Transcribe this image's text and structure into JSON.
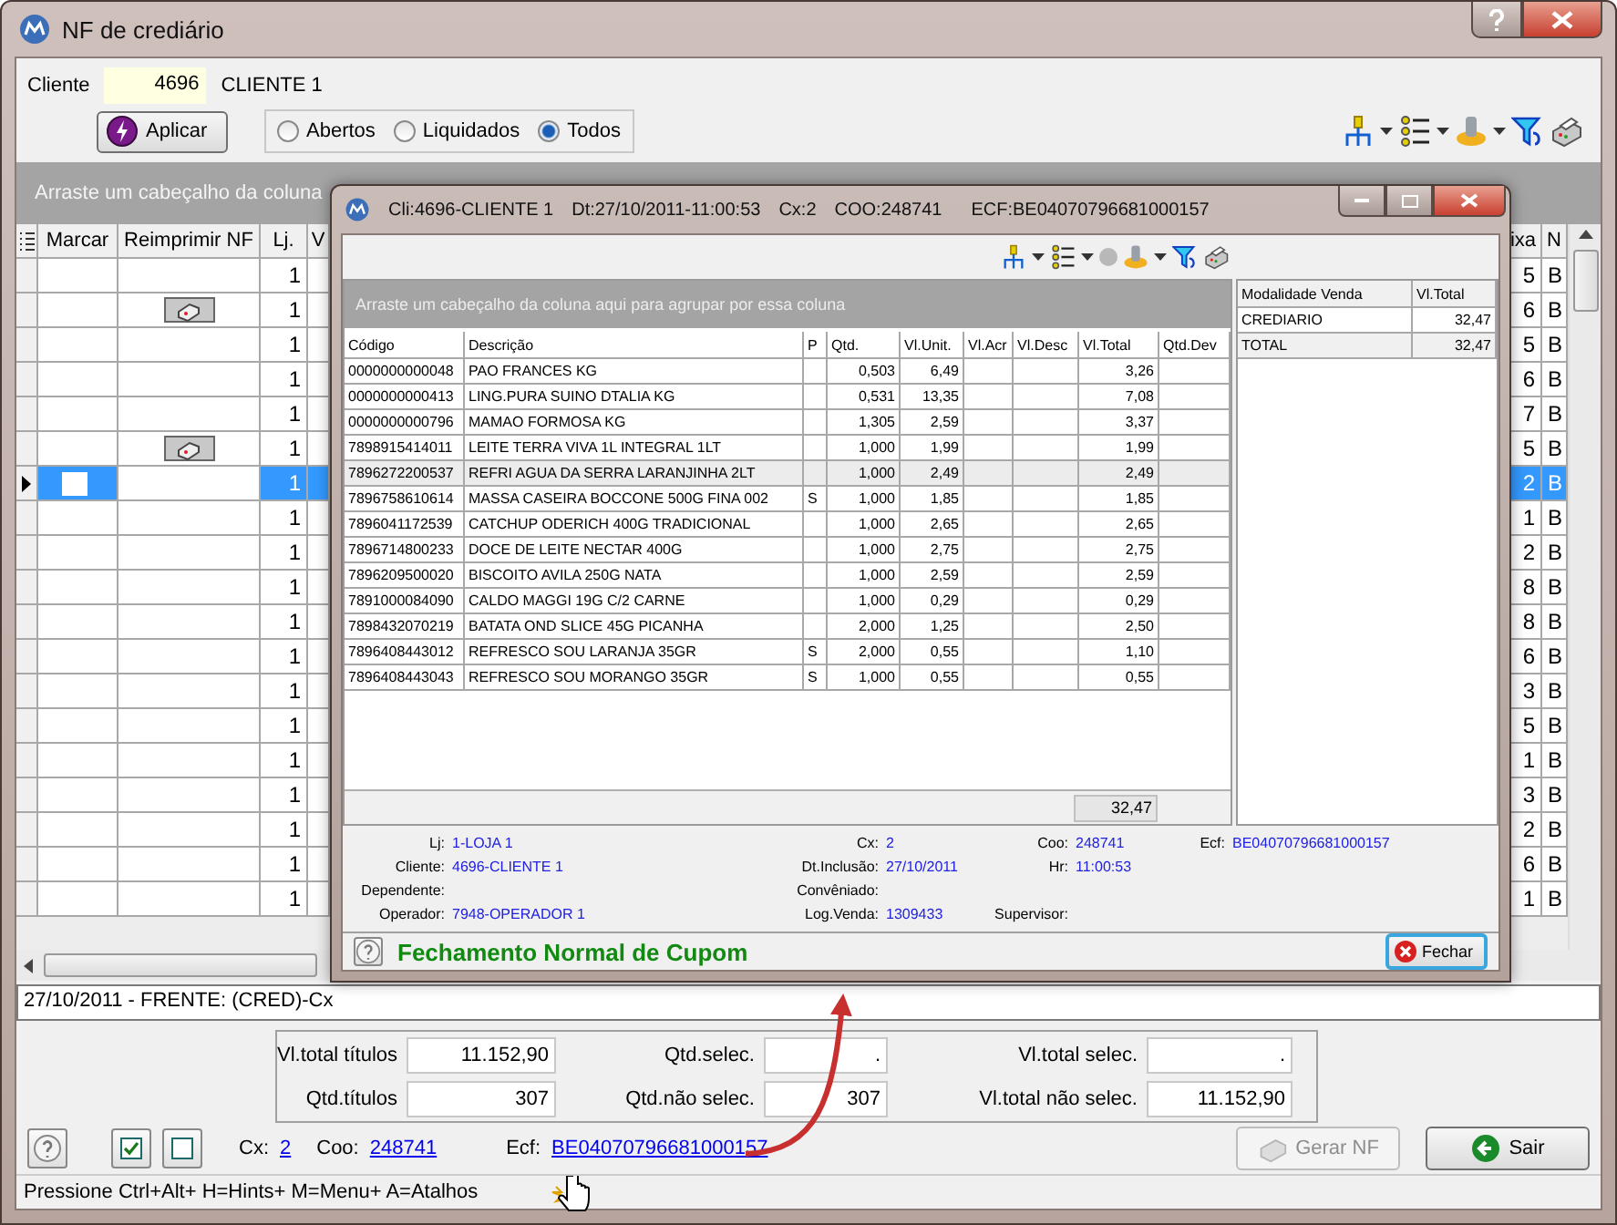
{
  "window": {
    "title": "NF de crediário"
  },
  "client": {
    "label": "Cliente",
    "code": "4696",
    "name": "CLIENTE 1"
  },
  "apply_button": "Aplicar",
  "filter": [
    {
      "label": "Abertos",
      "selected": false
    },
    {
      "label": "Liquidados",
      "selected": false
    },
    {
      "label": "Todos",
      "selected": true
    }
  ],
  "group_panel": "Arraste um cabeçalho da coluna",
  "grid": {
    "columns": [
      "Marcar",
      "Reimprimir NF",
      "Lj.",
      "V",
      "ixa",
      "N"
    ],
    "rows": [
      {
        "reprint": false,
        "lj": "1",
        "ixa": "5",
        "n": "B",
        "selected": false
      },
      {
        "reprint": true,
        "lj": "1",
        "ixa": "6",
        "n": "B",
        "selected": false
      },
      {
        "reprint": false,
        "lj": "1",
        "ixa": "5",
        "n": "B",
        "selected": false
      },
      {
        "reprint": false,
        "lj": "1",
        "ixa": "6",
        "n": "B",
        "selected": false
      },
      {
        "reprint": false,
        "lj": "1",
        "ixa": "7",
        "n": "B",
        "selected": false
      },
      {
        "reprint": true,
        "lj": "1",
        "ixa": "5",
        "n": "B",
        "selected": false
      },
      {
        "reprint": false,
        "lj": "1",
        "ixa": "2",
        "n": "B",
        "selected": true
      },
      {
        "reprint": false,
        "lj": "1",
        "ixa": "1",
        "n": "B",
        "selected": false
      },
      {
        "reprint": false,
        "lj": "1",
        "ixa": "2",
        "n": "B",
        "selected": false
      },
      {
        "reprint": false,
        "lj": "1",
        "ixa": "8",
        "n": "B",
        "selected": false
      },
      {
        "reprint": false,
        "lj": "1",
        "ixa": "8",
        "n": "B",
        "selected": false
      },
      {
        "reprint": false,
        "lj": "1",
        "ixa": "6",
        "n": "B",
        "selected": false
      },
      {
        "reprint": false,
        "lj": "1",
        "ixa": "3",
        "n": "B",
        "selected": false
      },
      {
        "reprint": false,
        "lj": "1",
        "ixa": "5",
        "n": "B",
        "selected": false
      },
      {
        "reprint": false,
        "lj": "1",
        "ixa": "1",
        "n": "B",
        "selected": false
      },
      {
        "reprint": false,
        "lj": "1",
        "ixa": "3",
        "n": "B",
        "selected": false
      },
      {
        "reprint": false,
        "lj": "1",
        "ixa": "2",
        "n": "B",
        "selected": false
      },
      {
        "reprint": false,
        "lj": "1",
        "ixa": "6",
        "n": "B",
        "selected": false
      },
      {
        "reprint": false,
        "lj": "1",
        "ixa": "1",
        "n": "B",
        "selected": false
      }
    ]
  },
  "status_line": "27/10/2011 - FRENTE: (CRED)-Cx",
  "dialog": {
    "title_parts": [
      "Cli:4696-CLIENTE 1",
      "Dt:27/10/2011-11:00:53",
      "Cx:2",
      "COO:248741",
      "ECF:BE04070796681000157"
    ],
    "group_panel": "Arraste um cabeçalho da coluna aqui para agrupar por essa coluna",
    "columns": [
      "Código",
      "Descrição",
      "P",
      "Qtd.",
      "Vl.Unit.",
      "Vl.Acr",
      "Vl.Desc",
      "Vl.Total",
      "Qtd.Dev"
    ],
    "items": [
      {
        "code": "0000000000048",
        "desc": "PAO FRANCES KG",
        "qty": "0,503",
        "unit": "6,49",
        "total": "3,26",
        "selected": false
      },
      {
        "code": "0000000000413",
        "desc": "LING.PURA SUINO DTALIA KG",
        "qty": "0,531",
        "unit": "13,35",
        "total": "7,08",
        "selected": false
      },
      {
        "code": "0000000000796",
        "desc": "MAMAO FORMOSA KG",
        "qty": "1,305",
        "unit": "2,59",
        "total": "3,37",
        "selected": false
      },
      {
        "code": "7898915414011",
        "desc": "LEITE TERRA VIVA 1L INTEGRAL 1LT",
        "qty": "1,000",
        "unit": "1,99",
        "total": "1,99",
        "selected": false
      },
      {
        "code": "7896272200537",
        "desc": "REFRI AGUA DA SERRA LARANJINHA 2LT",
        "qty": "1,000",
        "unit": "2,49",
        "total": "2,49",
        "selected": true
      },
      {
        "code": "7896758610614",
        "desc": "MASSA CASEIRA BOCCONE 500G FINA 002",
        "p": "S",
        "qty": "1,000",
        "unit": "1,85",
        "total": "1,85",
        "selected": false
      },
      {
        "code": "7896041172539",
        "desc": "CATCHUP ODERICH 400G TRADICIONAL",
        "qty": "1,000",
        "unit": "2,65",
        "total": "2,65",
        "selected": false
      },
      {
        "code": "7896714800233",
        "desc": "DOCE DE LEITE NECTAR 400G",
        "qty": "1,000",
        "unit": "2,75",
        "total": "2,75",
        "selected": false
      },
      {
        "code": "7896209500020",
        "desc": "BISCOITO AVILA 250G NATA",
        "qty": "1,000",
        "unit": "2,59",
        "total": "2,59",
        "selected": false
      },
      {
        "code": "7891000084090",
        "desc": "CALDO MAGGI 19G C/2 CARNE",
        "qty": "1,000",
        "unit": "0,29",
        "total": "0,29",
        "selected": false
      },
      {
        "code": "7898432070219",
        "desc": "BATATA OND SLICE 45G PICANHA",
        "qty": "2,000",
        "unit": "1,25",
        "total": "2,50",
        "selected": false
      },
      {
        "code": "7896408443012",
        "desc": "REFRESCO SOU LARANJA 35GR",
        "p": "S",
        "qty": "2,000",
        "unit": "0,55",
        "total": "1,10",
        "selected": false
      },
      {
        "code": "7896408443043",
        "desc": "REFRESCO SOU MORANGO 35GR",
        "p": "S",
        "qty": "1,000",
        "unit": "0,55",
        "total": "0,55",
        "selected": false
      }
    ],
    "footer_total": "32,47",
    "payment": {
      "columns": [
        "Modalidade Venda",
        "Vl.Total"
      ],
      "rows": [
        {
          "name": "CREDIARIO",
          "value": "32,47"
        },
        {
          "name": "TOTAL",
          "value": "32,47"
        }
      ]
    },
    "info": [
      [
        {
          "label": "Lj:",
          "value": "1-LOJA 1"
        },
        {
          "label": "Cx:",
          "value": "2"
        },
        {
          "label": "Coo:",
          "value": "248741"
        },
        {
          "label": "Ecf:",
          "value": "BE04070796681000157"
        }
      ],
      [
        {
          "label": "Cliente:",
          "value": "4696-CLIENTE 1"
        },
        {
          "label": "Dt.Inclusão:",
          "value": "27/10/2011"
        },
        {
          "label": "Hr:",
          "value": "11:00:53"
        }
      ],
      [
        {
          "label": "Dependente:"
        },
        {
          "label": "Convêniado:"
        }
      ],
      [
        {
          "label": "Operador:",
          "value": "7948-OPERADOR 1"
        },
        {
          "label": "Log.Venda:",
          "value": "1309433"
        },
        {
          "label": "Supervisor:"
        }
      ]
    ],
    "message": "Fechamento Normal de Cupom",
    "close_button": "Fechar"
  },
  "totals": [
    {
      "label": "Vl.total títulos",
      "value": "11.152,90"
    },
    {
      "label": "Qtd.selec.",
      "value": "."
    },
    {
      "label": "Vl.total selec.",
      "value": "."
    },
    {
      "label": "Qtd.títulos",
      "value": "307"
    },
    {
      "label": "Qtd.não selec.",
      "value": "307"
    },
    {
      "label": "Vl.total não selec.",
      "value": "11.152,90"
    }
  ],
  "footer": [
    {
      "label": "Cx:",
      "value": "2"
    },
    {
      "label": "Coo:",
      "value": "248741"
    },
    {
      "label": "Ecf:",
      "value": "BE04070796681000157"
    }
  ],
  "buttons": [
    {
      "kind": "print",
      "label": "Gerar NF",
      "disabled": true
    },
    {
      "kind": "exit",
      "label": "Sair",
      "disabled": false
    }
  ],
  "status_bar": "Pressione Ctrl+Alt+ H=Hints+ M=Menu+ A=Atalhos"
}
